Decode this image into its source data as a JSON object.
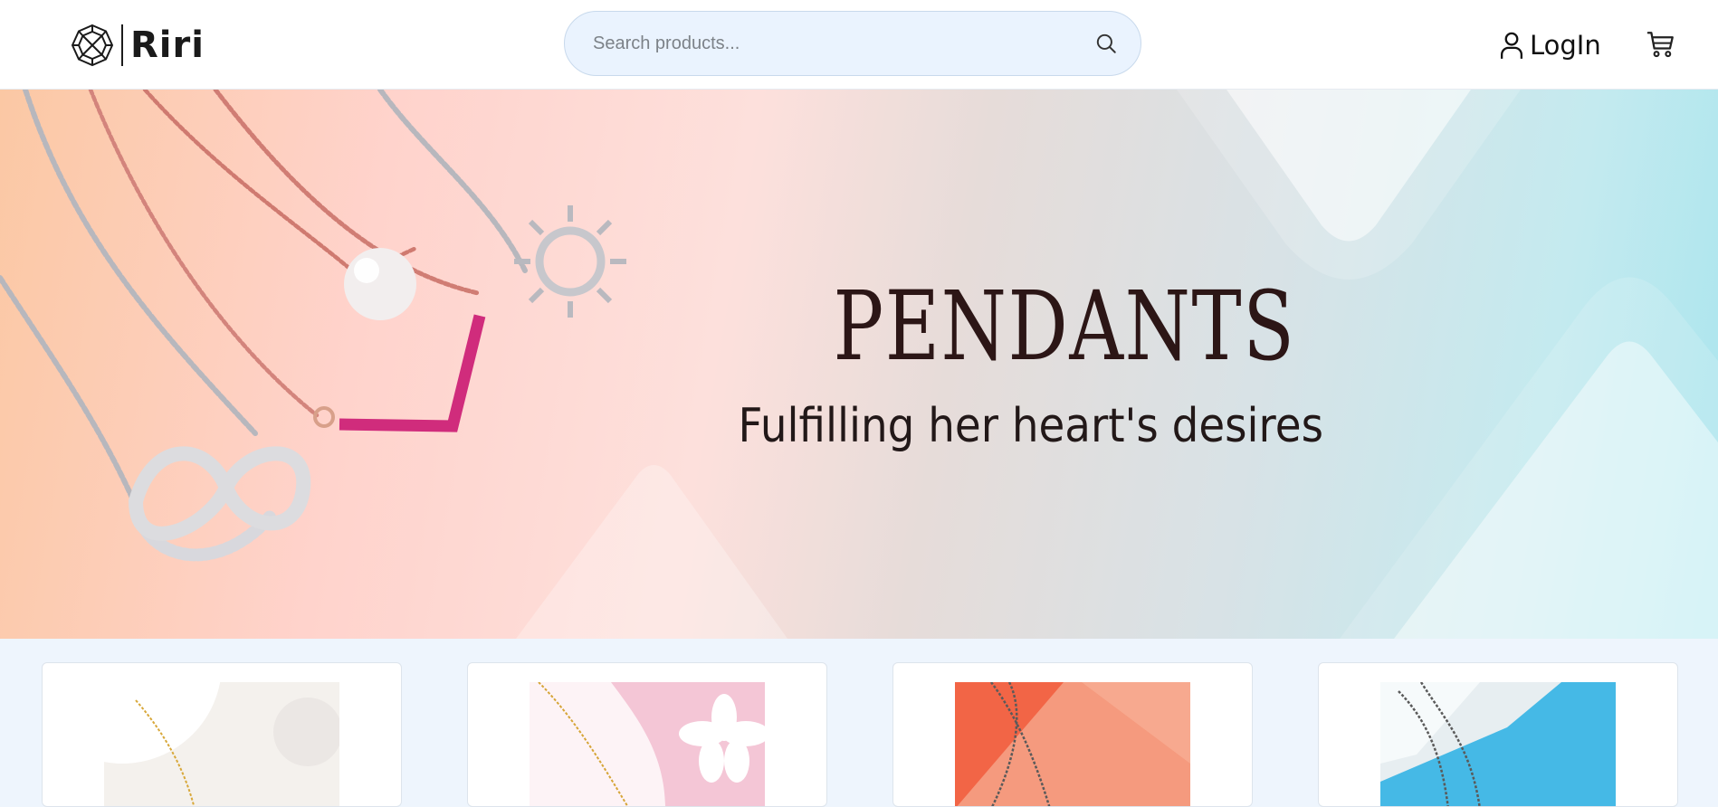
{
  "header": {
    "logo_text": "Riri",
    "logo_icon": "gem-icon",
    "search": {
      "placeholder": "Search products...",
      "value": "",
      "icon": "search-icon"
    },
    "login_label": "LogIn",
    "login_icon": "user-icon",
    "cart_icon": "cart-icon"
  },
  "hero": {
    "title": "PENDANTS",
    "subtitle": "Fulfilling her heart's desires",
    "colors": {
      "title": "#2c1616",
      "bg_left": "#fbc8a4",
      "bg_right": "#a9e5ee"
    }
  },
  "products": [
    {
      "image": "gold-necklace-photo",
      "colors": [
        "#f3efe9",
        "#d8a83a"
      ]
    },
    {
      "image": "gold-necklace-flower-photo",
      "colors": [
        "#f4c6d6",
        "#d6a538"
      ]
    },
    {
      "image": "silver-chain-orange-photo",
      "colors": [
        "#f07a5c",
        "#5a5a5a"
      ]
    },
    {
      "image": "silver-chain-blue-photo",
      "colors": [
        "#45b9e6",
        "#5a5a5a"
      ]
    }
  ],
  "theme": {
    "page_bg": "#eef5fd",
    "search_bg": "#eaf3fe",
    "search_border": "#c8d9ec"
  }
}
